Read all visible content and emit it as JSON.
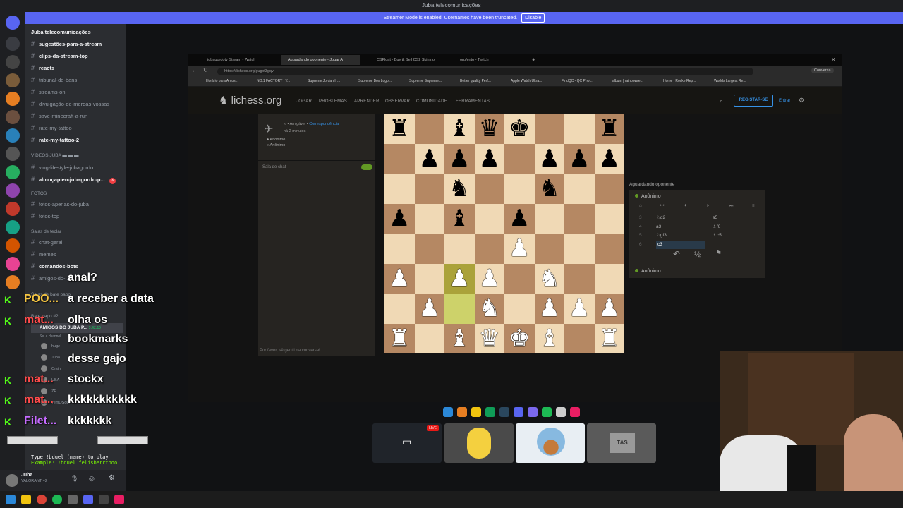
{
  "window": {
    "title": "Juba telecomunicações"
  },
  "streamer_banner": {
    "text": "Streamer Mode is enabled. Usernames have been truncated.",
    "button": "Disable"
  },
  "server": {
    "name": "Juba telecomunicações"
  },
  "channels": [
    {
      "label": "sugestões-para-a-stream",
      "bold": true
    },
    {
      "label": "clips-da-stream-top",
      "bold": true
    },
    {
      "label": "reacts",
      "bold": true
    },
    {
      "label": "tribunal-de-bans",
      "bold": false
    },
    {
      "label": "streams-on",
      "bold": false
    },
    {
      "label": "divulgação-de-merdas-vossas",
      "bold": false
    },
    {
      "label": "save-minecraft-a-run",
      "bold": false
    },
    {
      "label": "rate-my-tattoo",
      "bold": false
    },
    {
      "label": "rate-my-tattoo-2",
      "bold": true
    }
  ],
  "categories": {
    "videos": "VIDEOS JUBA ▬ ▬ ▬",
    "fotos": "FOTOS",
    "salas": "Salas de teclar",
    "bate": "Salas de bate papo"
  },
  "channels2": [
    {
      "label": "vlog-lifestyle-jubagordo",
      "bold": false
    },
    {
      "label": "almoçapien-jubagordo-p...",
      "bold": true,
      "badge": "3"
    }
  ],
  "channels3": [
    {
      "label": "fotos-apenas-do-juba"
    },
    {
      "label": "fotos-top"
    }
  ],
  "channels4": [
    {
      "label": "chat-geral",
      "bold": false
    },
    {
      "label": "memes",
      "bold": false
    },
    {
      "label": "comandos-bots",
      "bold": true
    },
    {
      "label": "amigos-do-...",
      "bold": false
    }
  ],
  "voice": {
    "channel1": "Bate papo #2",
    "channel2": "AMIGOS DO JUBA P...",
    "time": "3:42:10",
    "sub": "Sel a channel",
    "users": [
      "hugz",
      "Juba",
      "Orsini",
      "UBA",
      "ZÉ",
      "vemQSoul"
    ]
  },
  "user": {
    "name": "Juba",
    "status": "VALORANT +2"
  },
  "browser": {
    "tabs": [
      "jubagordotv Stream - Watch",
      "Aguardando oponente - Jogar A",
      "CSFloat - Buy & Sell CS2 Skins o",
      "oru/ento - Twitch"
    ],
    "url": "https://lichess.org/gugxt3gqv",
    "profile": "Conversa",
    "bookmarks": [
      "Horário para Arcos...",
      "NO.1 FACTORY | Y...",
      "Supreme Jordan H...",
      "Supreme Box Logo...",
      "Supreme Supreme...",
      "Better quality Perf...",
      "Apple Watch Ultra...",
      "FindQC - QC Phot...",
      "album | rainbowre...",
      "Home | RocketRep...",
      "Worlds Largest Re..."
    ]
  },
  "lichess": {
    "logo": "lichess.org",
    "nav": [
      "JOGAR",
      "PROBLEMAS",
      "APRENDER",
      "OBSERVAR",
      "COMUNIDADE",
      "FERRAMENTAS"
    ],
    "register": "REGISTAR-SE",
    "login": "Entrar",
    "game": {
      "line1": "∞ • Amigável •",
      "line1_link": "Correspondência",
      "line2": "há 2 minutos",
      "player_a": "Anônimo",
      "player_b": "Anônimo"
    },
    "chat": {
      "title": "Sala de chat",
      "footer": "Por favor, sê gentil na conversa!"
    },
    "waiting": "Aguardando oponente",
    "top_player": "Anônimo",
    "bottom_player": "Anônimo",
    "moves": [
      {
        "n": "3",
        "w": "♘d2",
        "b": "a5"
      },
      {
        "n": "4",
        "w": "a3",
        "b": "♗f6"
      },
      {
        "n": "5",
        "w": "♘gf3",
        "b": "♗c5"
      },
      {
        "n": "6",
        "w": "c3",
        "b": ""
      }
    ],
    "board": [
      [
        "r",
        "",
        "b",
        "q",
        "k",
        "",
        "",
        "r"
      ],
      [
        "",
        "p",
        "p",
        "p",
        "",
        "p",
        "p",
        "p"
      ],
      [
        "",
        "",
        "n",
        "",
        "",
        "n",
        "",
        ""
      ],
      [
        "p",
        "",
        "b",
        "",
        "p",
        "",
        "",
        ""
      ],
      [
        "",
        "",
        "",
        "",
        "P",
        "",
        "",
        ""
      ],
      [
        "P",
        "",
        "P",
        "P",
        "",
        "N",
        "",
        ""
      ],
      [
        "",
        "P",
        "",
        "N",
        "",
        "P",
        "P",
        "P"
      ],
      [
        "R",
        "",
        "B",
        "Q",
        "K",
        "B",
        "",
        "R"
      ]
    ],
    "highlight": [
      [
        5,
        2
      ],
      [
        6,
        2
      ]
    ]
  },
  "chat_overlay": [
    {
      "user": "",
      "msg": "anal?",
      "color": "#fff"
    },
    {
      "user": "POO...",
      "msg": "a receber a data",
      "color": "#f5c542"
    },
    {
      "user": "mat...",
      "msg": "olha os",
      "color": "#ff4b4b"
    },
    {
      "user": "",
      "msg": "bookmarks",
      "color": "#fff"
    },
    {
      "user": "",
      "msg": "desse gajo",
      "color": "#fff"
    },
    {
      "user": "mat...",
      "msg": "stockx",
      "color": "#ff4b4b"
    },
    {
      "user": "mat...",
      "msg": "kkkkkkkkkkk",
      "color": "#ff4b4b"
    },
    {
      "user": "Filet...",
      "msg": "kkkkkkk",
      "color": "#c56bff"
    }
  ],
  "duel": {
    "line1": "Type !bduel (name) to play",
    "line2": "Example: !bduel felisberrtooo"
  },
  "thumb_badge": "LIVE"
}
